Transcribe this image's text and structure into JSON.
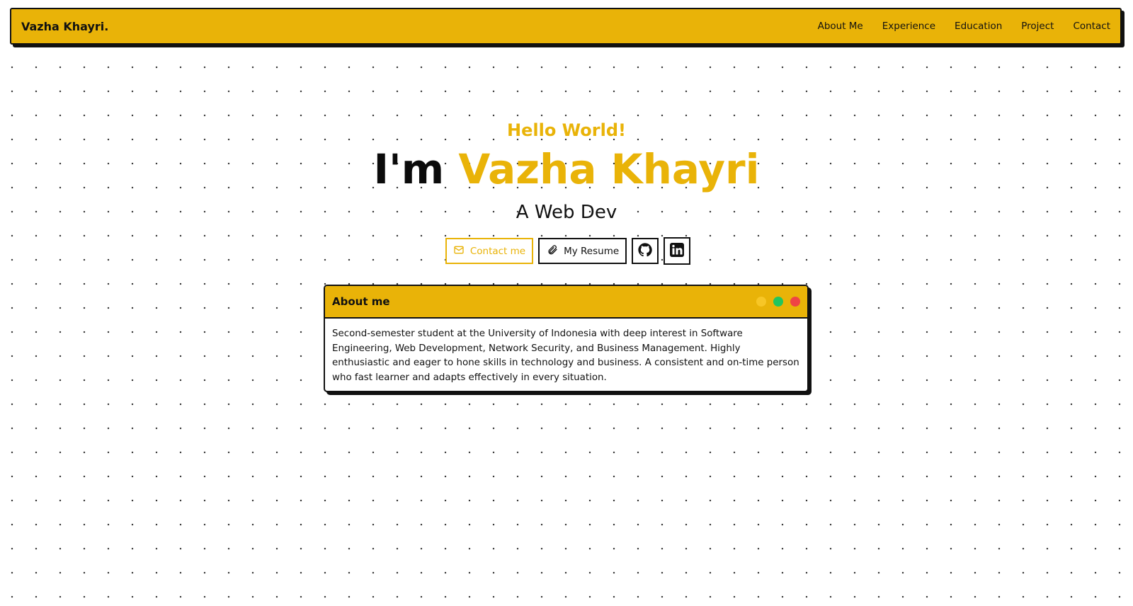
{
  "navbar": {
    "brand": "Vazha Khayri.",
    "links": [
      "About Me",
      "Experience",
      "Education",
      "Project",
      "Contact"
    ]
  },
  "hero": {
    "greeting": "Hello World!",
    "prefix": "I'm",
    "name": "Vazha Khayri",
    "role": "A Web Dev"
  },
  "buttons": {
    "contact": {
      "label": "Contact me",
      "icon": "mail-icon"
    },
    "resume": {
      "label": "My Resume",
      "icon": "paperclip-icon"
    },
    "github": {
      "icon": "github-icon"
    },
    "linkedin": {
      "icon": "linkedin-icon"
    }
  },
  "about_window": {
    "title": "About me",
    "body": "Second-semester student at the University of Indonesia with deep interest in Software Engineering, Web Development, Network Security, and Business Management. Highly enthusiastic and eager to hone skills in technology and business. A consistent and on-time person who fast learner and adapts effectively in every situation."
  },
  "colors": {
    "accent": "#e9b308",
    "border": "#111111",
    "dot_yellow": "#f7c626",
    "dot_green": "#22c55e",
    "dot_red": "#ef4444"
  }
}
